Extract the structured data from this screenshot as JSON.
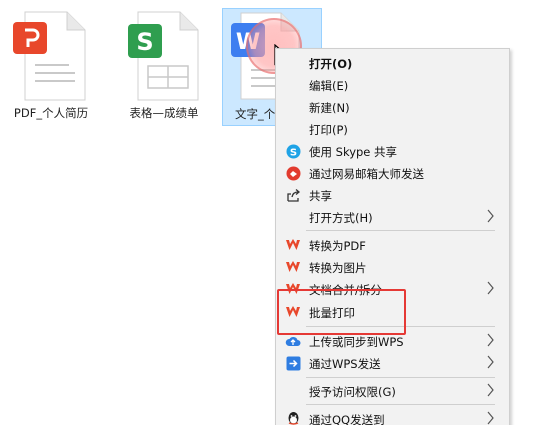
{
  "desktop": {
    "files": [
      {
        "label": "PDF_个人简历",
        "badge": "PDF",
        "color": "#e8472b"
      },
      {
        "label": "表格—成绩单",
        "badge": "S",
        "color": "#2f9e4f"
      },
      {
        "label": "文字_个",
        "badge": "W",
        "color": "#3d7ef0"
      }
    ]
  },
  "context_menu": {
    "items": [
      {
        "label": "打开(O)",
        "bold": true
      },
      {
        "label": "编辑(E)"
      },
      {
        "label": "新建(N)"
      },
      {
        "label": "打印(P)"
      },
      {
        "label": "使用 Skype 共享",
        "icon": "skype-icon"
      },
      {
        "label": "通过网易邮箱大师发送",
        "icon": "netease-mail-icon"
      },
      {
        "label": "共享",
        "icon": "share-icon"
      },
      {
        "label": "打开方式(H)",
        "submenu": true
      },
      {
        "label": "转换为PDF",
        "icon": "wps-icon"
      },
      {
        "label": "转换为图片",
        "icon": "wps-icon"
      },
      {
        "label": "文档合并/拆分",
        "icon": "wps-icon",
        "submenu": true
      },
      {
        "label": "批量打印",
        "icon": "wps-icon"
      },
      {
        "label": "上传或同步到WPS",
        "icon": "cloud-upload-icon",
        "submenu": true
      },
      {
        "label": "通过WPS发送",
        "icon": "wps-send-icon",
        "submenu": true
      },
      {
        "label": "授予访问权限(G)",
        "submenu": true
      },
      {
        "label": "通过QQ发送到",
        "icon": "qq-icon",
        "submenu": true
      }
    ]
  },
  "colors": {
    "accent_red": "#e53935",
    "wps_red": "#e8472b",
    "selection_blue": "#cce8ff"
  }
}
